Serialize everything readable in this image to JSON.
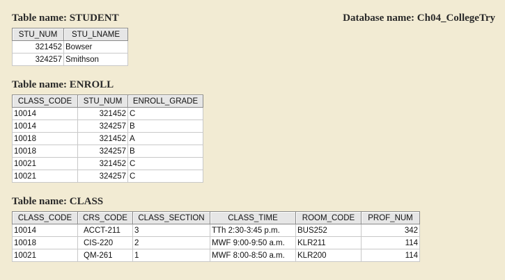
{
  "database_label": "Database name: Ch04_CollegeTry",
  "student": {
    "title": "Table name: STUDENT",
    "columns": [
      "STU_NUM",
      "STU_LNAME"
    ],
    "rows": [
      [
        "321452",
        "Bowser"
      ],
      [
        "324257",
        "Smithson"
      ]
    ]
  },
  "enroll": {
    "title": "Table name: ENROLL",
    "columns": [
      "CLASS_CODE",
      "STU_NUM",
      "ENROLL_GRADE"
    ],
    "rows": [
      [
        "10014",
        "321452",
        "C"
      ],
      [
        "10014",
        "324257",
        "B"
      ],
      [
        "10018",
        "321452",
        "A"
      ],
      [
        "10018",
        "324257",
        "B"
      ],
      [
        "10021",
        "321452",
        "C"
      ],
      [
        "10021",
        "324257",
        "C"
      ]
    ]
  },
  "class": {
    "title": "Table name: CLASS",
    "columns": [
      "CLASS_CODE",
      "CRS_CODE",
      "CLASS_SECTION",
      "CLASS_TIME",
      "ROOM_CODE",
      "PROF_NUM"
    ],
    "rows": [
      [
        "10014",
        "ACCT-211",
        "3",
        "TTh 2:30-3:45 p.m.",
        "BUS252",
        "342"
      ],
      [
        "10018",
        "CIS-220",
        "2",
        "MWF 9:00-9:50 a.m.",
        "KLR211",
        "114"
      ],
      [
        "10021",
        "QM-261",
        "1",
        "MWF 8:00-8:50 a.m.",
        "KLR200",
        "114"
      ]
    ]
  }
}
